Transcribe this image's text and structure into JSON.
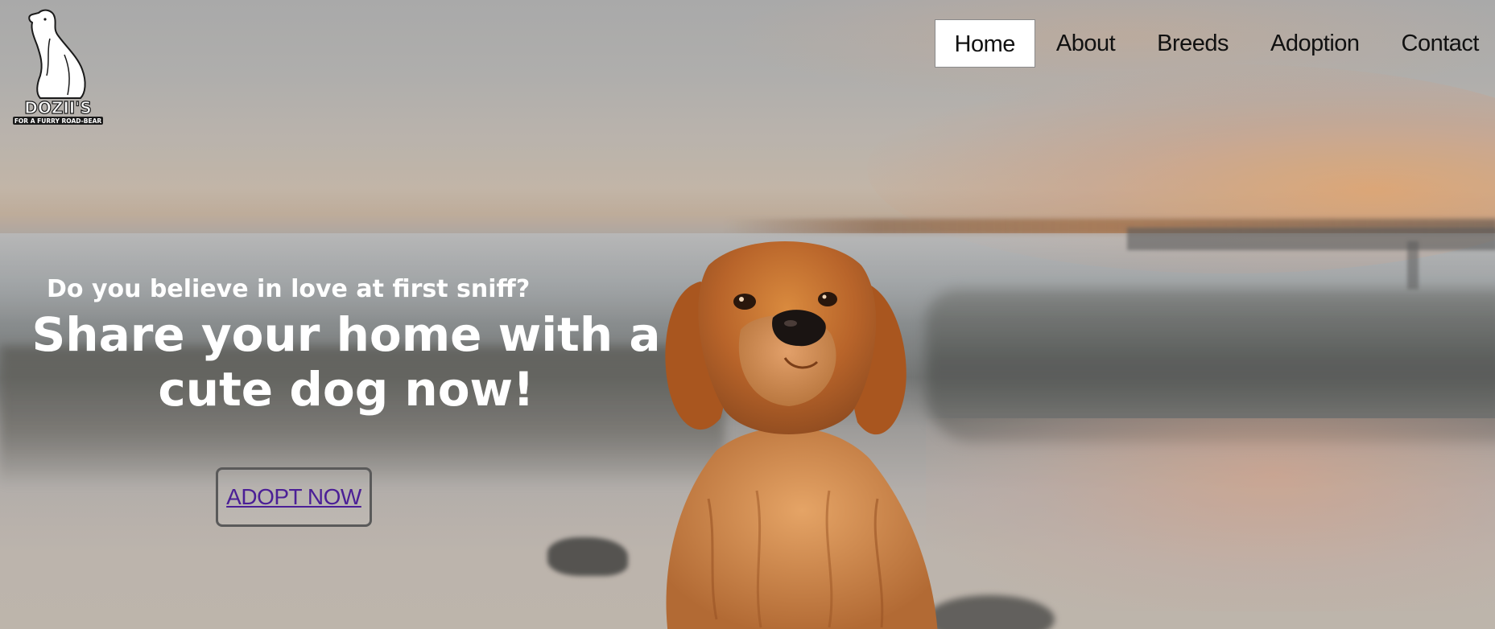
{
  "logo": {
    "brand": "DOZII'S",
    "tagline": "FOR A FURRY ROAD-BEAR"
  },
  "nav": {
    "items": [
      {
        "label": "Home",
        "active": true
      },
      {
        "label": "About",
        "active": false
      },
      {
        "label": "Breeds",
        "active": false
      },
      {
        "label": "Adoption",
        "active": false
      },
      {
        "label": "Contact",
        "active": false
      }
    ]
  },
  "hero": {
    "tagline": "Do you believe in love at first sniff?",
    "headline_line1": "Share your home with a",
    "headline_line2": "cute dog now!",
    "cta_label": "ADOPT NOW",
    "image_subject": "golden-retriever-on-beach-at-sunset"
  },
  "colors": {
    "cta_link": "#4b1f96",
    "nav_active_bg": "#ffffff",
    "nav_text": "#111111",
    "hero_text": "#ffffff"
  }
}
